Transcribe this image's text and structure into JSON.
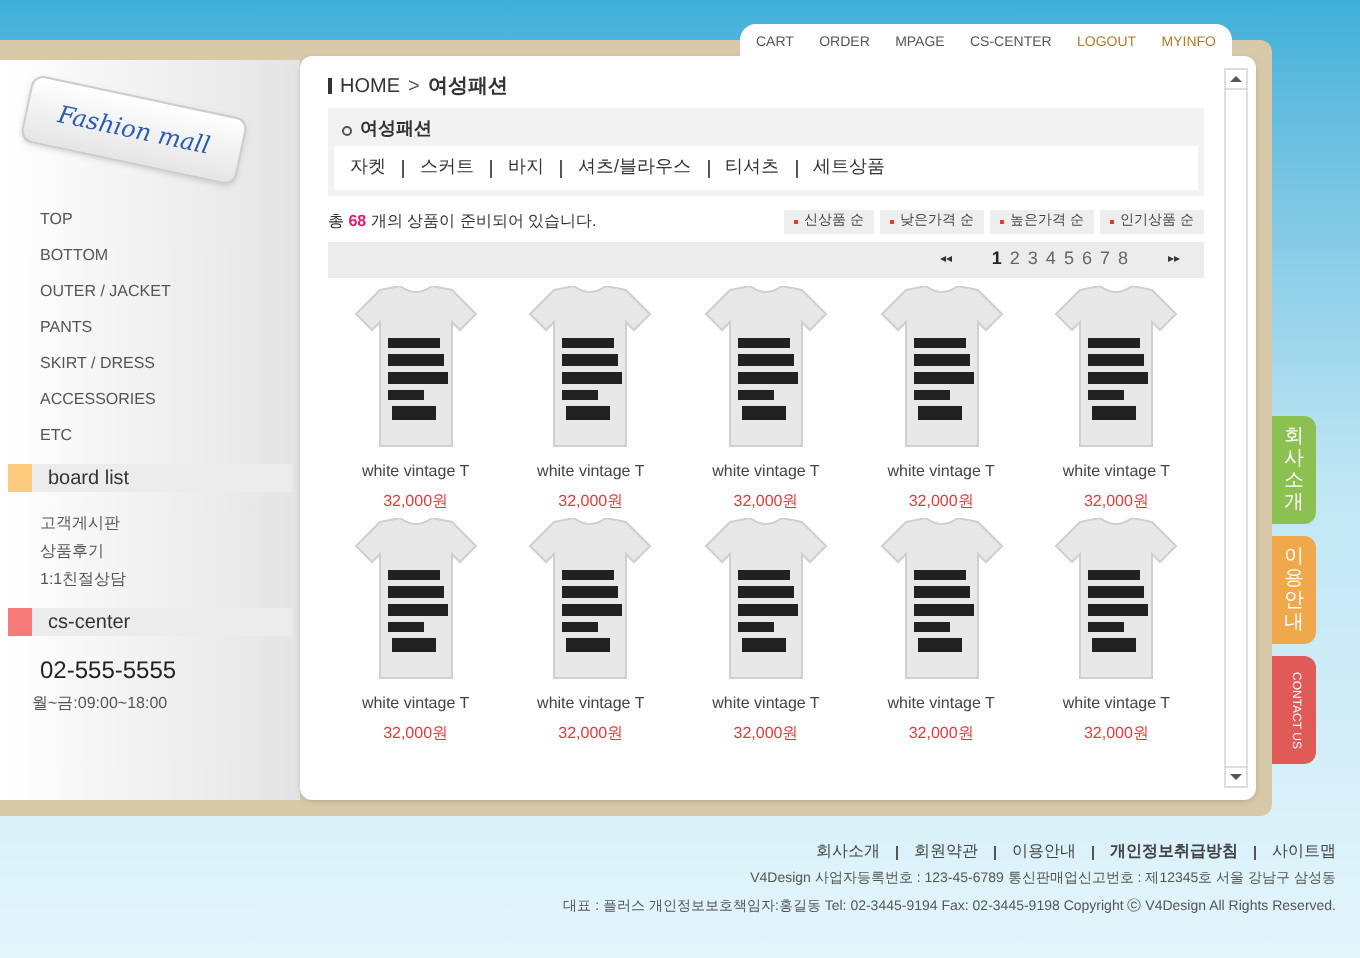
{
  "logo": {
    "text": "Fashion mall"
  },
  "top_menu": [
    {
      "label": "CART",
      "highlighted": false
    },
    {
      "label": "ORDER",
      "highlighted": false
    },
    {
      "label": "MPAGE",
      "highlighted": false
    },
    {
      "label": "CS-CENTER",
      "highlighted": false
    },
    {
      "label": "LOGOUT",
      "highlighted": true
    },
    {
      "label": "MYINFO",
      "highlighted": true
    }
  ],
  "categories": [
    "TOP",
    "BOTTOM",
    "OUTER / JACKET",
    "PANTS",
    "SKIRT / DRESS",
    "ACCESSORIES",
    "ETC"
  ],
  "board_list": {
    "title": "board list",
    "color": "#fccb7e",
    "items": [
      "고객게시판",
      "상품후기",
      "1:1친절상담"
    ]
  },
  "cs_center": {
    "title": "cs-center",
    "color": "#f77a7a",
    "phone": "02-555-5555",
    "hours": "월~금:09:00~18:00"
  },
  "breadcrumb": {
    "home": "HOME",
    "separator": ">",
    "current": "여성패션"
  },
  "category_box": {
    "title": "여성패션",
    "links": [
      "자켓",
      "스커트",
      "바지",
      "셔츠/블라우스",
      "티셔츠",
      "세트상품"
    ]
  },
  "count": {
    "prefix": "총",
    "number": "68",
    "suffix": "개의 상품이 준비되어 있습니다."
  },
  "sort_buttons": [
    "신상품 순",
    "낮은가격 순",
    "높은가격 순",
    "인기상품 순"
  ],
  "pager": {
    "prev": "◂◂",
    "next": "▸▸",
    "pages": [
      {
        "label": "1",
        "selected": true
      },
      {
        "label": "2",
        "selected": false
      },
      {
        "label": "3",
        "selected": false
      },
      {
        "label": "4",
        "selected": false
      },
      {
        "label": "5",
        "selected": false
      },
      {
        "label": "6",
        "selected": false
      },
      {
        "label": "7",
        "selected": false
      },
      {
        "label": "8",
        "selected": false
      }
    ]
  },
  "products": [
    {
      "name": "white vintage T",
      "price": "32,000원"
    },
    {
      "name": "white vintage T",
      "price": "32,000원"
    },
    {
      "name": "white vintage T",
      "price": "32,000원"
    },
    {
      "name": "white vintage T",
      "price": "32,000원"
    },
    {
      "name": "white vintage T",
      "price": "32,000원"
    },
    {
      "name": "white vintage T",
      "price": "32,000원"
    },
    {
      "name": "white vintage T",
      "price": "32,000원"
    },
    {
      "name": "white vintage T",
      "price": "32,000원"
    },
    {
      "name": "white vintage T",
      "price": "32,000원"
    },
    {
      "name": "white vintage T",
      "price": "32,000원"
    }
  ],
  "side_tabs": [
    {
      "label": "회사소개",
      "kind": "korean",
      "color": "#8cc152"
    },
    {
      "label": "이용안내",
      "kind": "korean",
      "color": "#f0a84a"
    },
    {
      "label": "CONTACT US",
      "kind": "latin",
      "color": "#e05a57"
    }
  ],
  "footer": {
    "links": [
      {
        "label": "회사소개",
        "bold": false
      },
      {
        "label": "회원약관",
        "bold": false
      },
      {
        "label": "이용안내",
        "bold": false
      },
      {
        "label": "개인정보취급방침",
        "bold": true
      },
      {
        "label": "사이트맵",
        "bold": false
      }
    ],
    "lines": [
      "V4Design 사업자등록번호 : 123-45-6789 통신판매업신고번호 : 제12345호 서울 강남구 삼성동",
      "대표 : 플러스  개인정보보호책임자:홍길동 Tel: 02-3445-9194 Fax: 02-3445-9198 Copyright ⓒ V4Design All Rights Reserved."
    ]
  }
}
